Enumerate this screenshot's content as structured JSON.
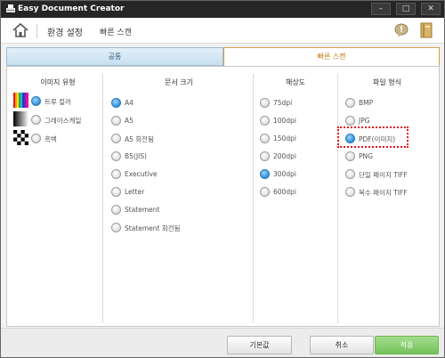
{
  "window": {
    "title": "Easy Document Creator",
    "controls": {
      "minimize": "–",
      "maximize": "□",
      "close": "✕"
    }
  },
  "header": {
    "settings_title": "환경 설정",
    "breadcrumb": "빠른 스캔"
  },
  "tabs": [
    {
      "label": "공통",
      "selected": false
    },
    {
      "label": "빠른 스캔",
      "selected": true
    }
  ],
  "columns": {
    "image_type": {
      "heading": "이미지 유형",
      "options": [
        {
          "label": "트루 컬러",
          "selected": true
        },
        {
          "label": "그레이스케일",
          "selected": false
        },
        {
          "label": "흑백",
          "selected": false
        }
      ]
    },
    "doc_size": {
      "heading": "문서 크기",
      "options": [
        {
          "label": "A4",
          "selected": true
        },
        {
          "label": "A5",
          "selected": false
        },
        {
          "label": "A5 회전됨",
          "selected": false
        },
        {
          "label": "B5(JIS)",
          "selected": false
        },
        {
          "label": "Executive",
          "selected": false
        },
        {
          "label": "Letter",
          "selected": false
        },
        {
          "label": "Statement",
          "selected": false
        },
        {
          "label": "Statement 회전됨",
          "selected": false
        }
      ]
    },
    "resolution": {
      "heading": "해상도",
      "options": [
        {
          "label": "75dpi",
          "selected": false
        },
        {
          "label": "100dpi",
          "selected": false
        },
        {
          "label": "150dpi",
          "selected": false
        },
        {
          "label": "200dpi",
          "selected": false
        },
        {
          "label": "300dpi",
          "selected": true
        },
        {
          "label": "600dpi",
          "selected": false
        }
      ]
    },
    "file_format": {
      "heading": "파일 형식",
      "options": [
        {
          "label": "BMP",
          "selected": false
        },
        {
          "label": "JPG",
          "selected": false
        },
        {
          "label": "PDF(이미지)",
          "selected": true
        },
        {
          "label": "PNG",
          "selected": false
        },
        {
          "label": "단일 페이지 TIFF",
          "selected": false
        },
        {
          "label": "복수 페이지 TIFF",
          "selected": false
        }
      ]
    }
  },
  "footer": {
    "default_label": "기본값",
    "cancel_label": "취소",
    "apply_label": "적용"
  },
  "colors": {
    "accent_tab": "#c27d10",
    "apply_green": "#74c35a",
    "highlight_red": "#e3151a",
    "radio_selected": "#2d8ed8"
  }
}
